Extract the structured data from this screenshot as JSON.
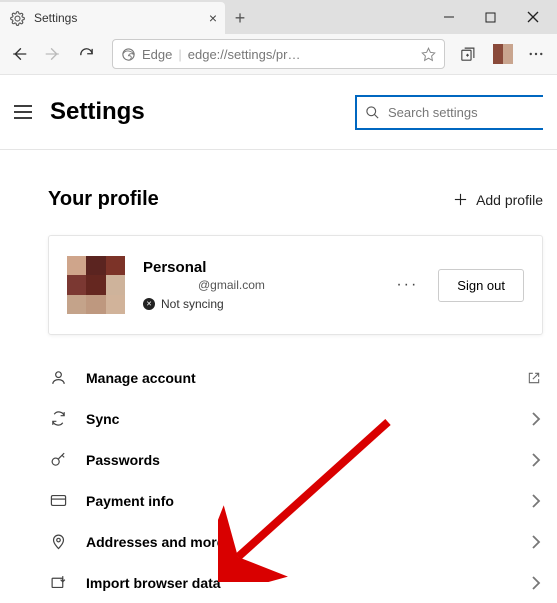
{
  "window": {
    "tab_title": "Settings",
    "address_brand": "Edge",
    "address_url": "edge://settings/pr…"
  },
  "header": {
    "title": "Settings",
    "search_placeholder": "Search settings"
  },
  "profile_section": {
    "title": "Your profile",
    "add_label": "Add profile"
  },
  "profile_card": {
    "name": "Personal",
    "email": "@gmail.com",
    "sync_status": "Not syncing",
    "more_label": "···",
    "signout_label": "Sign out"
  },
  "settings_items": [
    {
      "id": "manage-account",
      "label": "Manage account",
      "action": "external"
    },
    {
      "id": "sync",
      "label": "Sync",
      "action": "chevron"
    },
    {
      "id": "passwords",
      "label": "Passwords",
      "action": "chevron"
    },
    {
      "id": "payment-info",
      "label": "Payment info",
      "action": "chevron"
    },
    {
      "id": "addresses",
      "label": "Addresses and more",
      "action": "chevron"
    },
    {
      "id": "import-data",
      "label": "Import browser data",
      "action": "chevron"
    }
  ]
}
